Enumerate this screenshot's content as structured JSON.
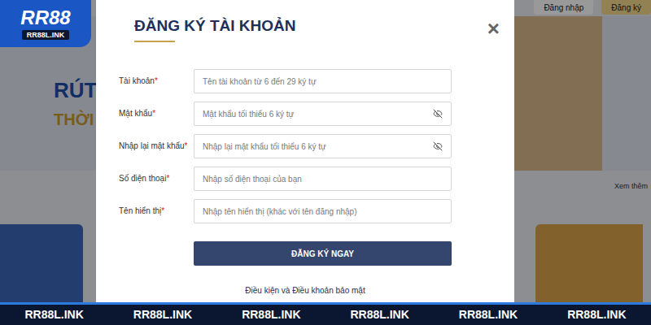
{
  "logo": {
    "name": "RR88",
    "domain": "RR88L.INK"
  },
  "header": {
    "buttons": [
      {
        "label": "Đăng nhập",
        "selected": false
      },
      {
        "label": "Đăng ký",
        "selected": true
      }
    ]
  },
  "banner": {
    "lines": [
      "RÚT",
      "THỜI"
    ]
  },
  "more_link": "Xem thêm",
  "modal": {
    "title": "ĐĂNG KÝ TÀI KHOẢN",
    "close": "×",
    "required_mark": "*",
    "fields": [
      {
        "label": "Tài khoản",
        "required": true,
        "kind": "text",
        "placeholder": "Tên tài khoản từ 6 đến 29 ký tự"
      },
      {
        "label": "Mật khẩu",
        "required": true,
        "kind": "password",
        "placeholder": "Mật khẩu tối thiểu 6 ký tự"
      },
      {
        "label": "Nhập lại mật khẩu",
        "required": true,
        "kind": "password",
        "placeholder": "Nhập lại mật khẩu tối thiểu 6 ký tự"
      },
      {
        "label": "Số điện thoại",
        "required": true,
        "kind": "text",
        "placeholder": "Nhập số điện thoại của bạn"
      },
      {
        "label": "Tên hiển thị",
        "required": true,
        "kind": "text",
        "placeholder": "Nhập tên hiển thị (khác với tên đăng nhập)"
      }
    ],
    "submit": "ĐĂNG KÝ NGAY",
    "terms": "Điều kiện và Điều khoản bảo mật"
  },
  "watermarks": [
    "RR88L.INK",
    "RR88L.INK",
    "RR88L.INK",
    "RR88L.INK",
    "RR88L.INK",
    "RR88L.INK"
  ]
}
